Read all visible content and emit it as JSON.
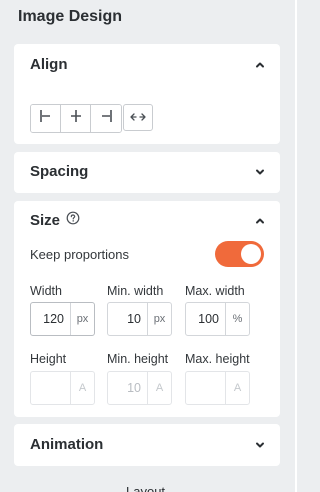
{
  "panel": {
    "title": "Image Design"
  },
  "align": {
    "title": "Align",
    "buttons": [
      "align-left",
      "align-center",
      "align-right"
    ],
    "extra": "stretch"
  },
  "spacing": {
    "title": "Spacing"
  },
  "size": {
    "title": "Size",
    "keep_label": "Keep proportions",
    "keep_on": true,
    "width": {
      "label": "Width",
      "value": "120",
      "unit": "px"
    },
    "min_width": {
      "label": "Min. width",
      "value": "10",
      "unit": "px"
    },
    "max_width": {
      "label": "Max. width",
      "value": "100",
      "unit": "%"
    },
    "height": {
      "label": "Height",
      "value": "",
      "unit": "A"
    },
    "min_height": {
      "label": "Min. height",
      "value": "10",
      "unit": "A"
    },
    "max_height": {
      "label": "Max. height",
      "value": "",
      "unit": "A"
    }
  },
  "animation": {
    "title": "Animation"
  },
  "footer": {
    "label": "Layout"
  },
  "colors": {
    "accent": "#f06a3b",
    "background": "#eceef0",
    "card": "#ffffff"
  },
  "icons": [
    "chevron-up-icon",
    "chevron-down-icon",
    "help-circle-icon",
    "align-left-icon",
    "align-center-icon",
    "align-right-icon",
    "stretch-icon"
  ]
}
